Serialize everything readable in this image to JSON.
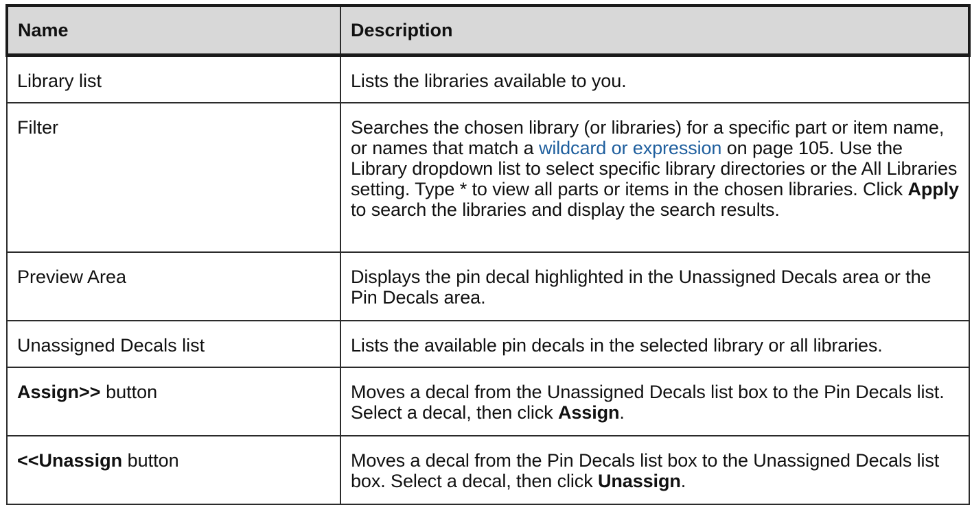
{
  "headers": {
    "name": "Name",
    "description": "Description"
  },
  "rows": [
    {
      "name": "Library list",
      "description": "Lists the libraries available to you."
    },
    {
      "name": "Filter",
      "desc_part1": "Searches the chosen library (or libraries) for a specific part or item name, or names that match a ",
      "link_text": "wildcard or expression",
      "desc_part2": " on page 105. Use the Library dropdown list to select specific library directories or the All Libraries setting. Type * to view all parts or items in the chosen libraries. Click ",
      "bold_text": "Apply",
      "desc_part3": " to search the libraries and display the search results."
    },
    {
      "name": "Preview Area",
      "description": "Displays the pin decal highlighted in the Unassigned Decals area or the Pin Decals area."
    },
    {
      "name": "Unassigned Decals list",
      "description": "Lists the available pin decals in the selected library or all libraries."
    },
    {
      "name_bold": "Assign>>",
      "name_rest": " button",
      "desc_part1": "Moves a decal from the Unassigned Decals list box to the Pin Decals list. Select a decal, then click ",
      "bold_text": "Assign",
      "desc_part2": "."
    },
    {
      "name_bold": "<<Unassign",
      "name_rest": " button",
      "desc_part1": "Moves a decal from the Pin Decals list box to the Unassigned Decals list box. Select a decal, then click ",
      "bold_text": "Unassign",
      "desc_part2": "."
    }
  ],
  "colors": {
    "header_bg": "#d8d8d8",
    "link": "#1f5f9e",
    "border": "#2b2b2b"
  }
}
